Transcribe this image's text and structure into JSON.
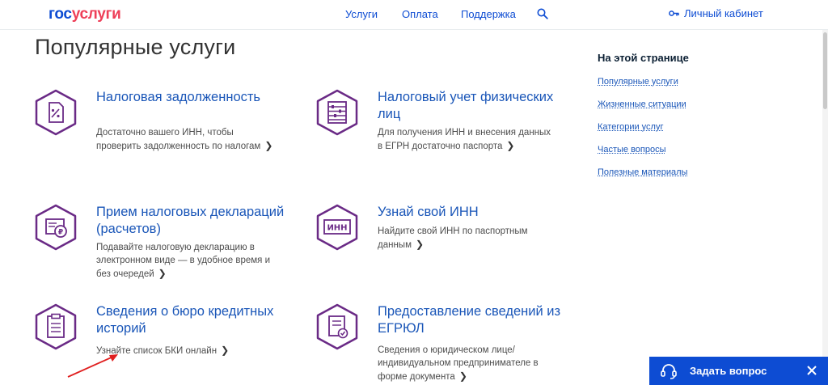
{
  "header": {
    "logo_gos": "гос",
    "logo_uslugi": "услуги",
    "nav": [
      "Услуги",
      "Оплата",
      "Поддержка"
    ],
    "cabinet_label": "Личный кабинет"
  },
  "page_title": "Популярные услуги",
  "cards": [
    {
      "title": "Налоговая задолженность",
      "desc": "Достаточно вашего ИНН, чтобы проверить задолженность по налогам"
    },
    {
      "title": "Налоговый учет физических лиц",
      "desc": "Для получения ИНН и внесения данных в ЕГРН достаточно паспорта"
    },
    {
      "title": "Прием налоговых деклараций (расчетов)",
      "desc": "Подавайте налоговую декларацию в электронном виде — в удобное время и без очередей"
    },
    {
      "title": "Узнай свой ИНН",
      "desc": "Найдите свой ИНН по паспортным данным",
      "icon_text": "ИНН"
    },
    {
      "title": "Сведения о бюро кредитных историй",
      "desc": "Узнайте список БКИ онлайн"
    },
    {
      "title": "Предоставление сведений из ЕГРЮЛ",
      "desc": "Сведения о юридическом лице/ индивидуальном предпринимателе в форме документа"
    }
  ],
  "toc": {
    "title": "На этой странице",
    "items": [
      "Популярные услуги",
      "Жизненные ситуации",
      "Категории услуг",
      "Частые вопросы",
      "Полезные материалы"
    ]
  },
  "ask_widget": {
    "label": "Задать вопрос"
  },
  "colors": {
    "primary": "#0d4cd3",
    "accent_purple": "#6a2a86",
    "logo_red": "#ee3f58",
    "arrow_red": "#e02020"
  }
}
